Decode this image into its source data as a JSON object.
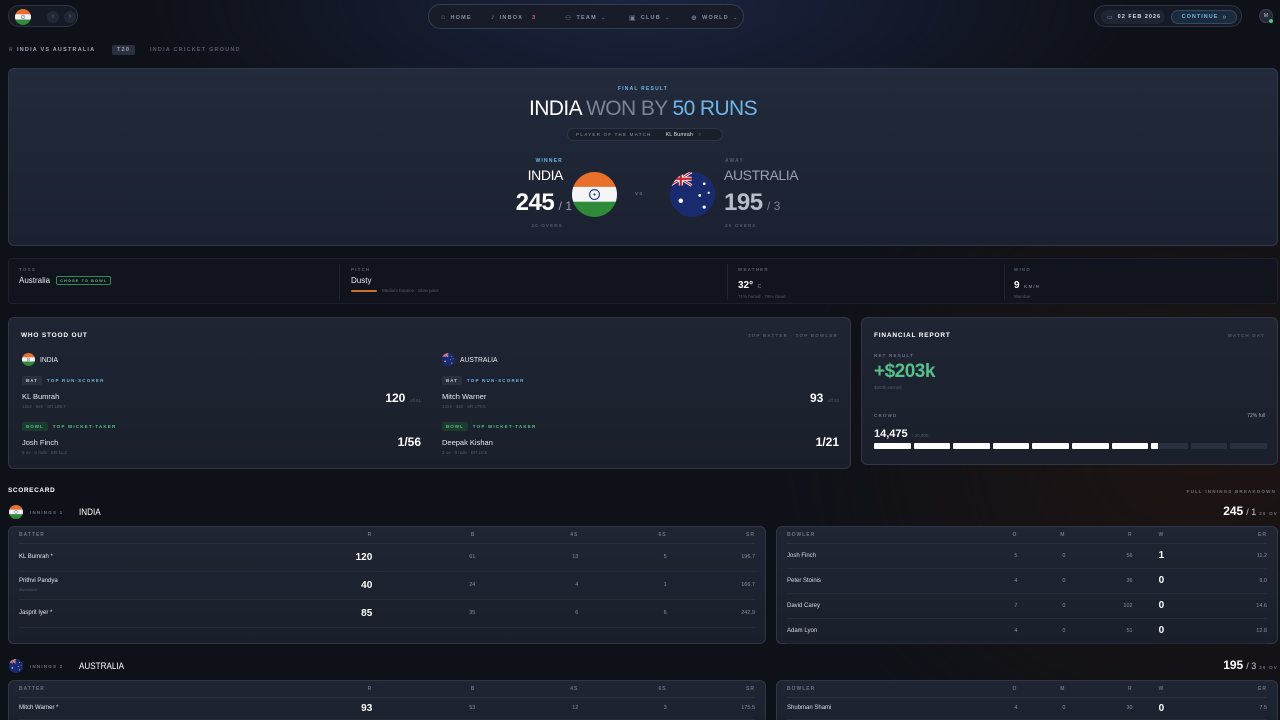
{
  "topbar": {
    "nav": [
      {
        "label": "HOME",
        "icon": "home-icon"
      },
      {
        "label": "INBOX",
        "icon": "bell-icon",
        "badge": "3"
      },
      {
        "label": "TEAM",
        "icon": "people-icon"
      },
      {
        "label": "CLUB",
        "icon": "briefcase-icon"
      },
      {
        "label": "WORLD",
        "icon": "globe-icon"
      }
    ],
    "date": "02 FEB 2026",
    "continue": "CONTINUE",
    "avatar": "M"
  },
  "breadcrumb": {
    "match": "INDIA VS AUSTRALIA",
    "format": "T20",
    "venue": "INDIA CRICKET GROUND"
  },
  "hero": {
    "kicker": "FINAL RESULT",
    "title_team": "INDIA",
    "title_mid": "WON BY",
    "title_margin": "50 RUNS",
    "potm_label": "PLAYER OF THE MATCH",
    "potm_name": "KL Bumrah",
    "home": {
      "tag": "WINNER",
      "name": "INDIA",
      "runs": "245",
      "wkts": "/ 1",
      "overs": "20 OVERS"
    },
    "vs": "VS",
    "away": {
      "tag": "AWAY",
      "name": "AUSTRALIA",
      "runs": "195",
      "wkts": "/ 3",
      "overs": "20 OVERS"
    }
  },
  "conditions": {
    "toss_label": "TOSS",
    "toss_value": "Australia",
    "toss_tag": "CHOSE TO BOWL",
    "pitch_label": "PITCH",
    "pitch_value": "Dusty",
    "pitch_desc": "Medium bounce · Slow pace",
    "weather_label": "WEATHER",
    "weather_value": "32°",
    "weather_unit": "C",
    "weather_desc": "71% humid · 76% cloud",
    "wind_label": "WIND",
    "wind_value": "9",
    "wind_unit": "KM/H",
    "wind_desc": "Mumbai"
  },
  "standout": {
    "title": "WHO STOOD OUT",
    "subtitle": "TOP BATTER · TOP BOWLER",
    "india": {
      "name": "INDIA",
      "bat_tag": "BAT",
      "bat_role": "TOP RUN-SCORER",
      "bat_player": "KL Bumrah",
      "bat_detail": "12x4 · 5x6 · SR 196.7",
      "bat_runs": "120",
      "bat_balls": "off 61",
      "bowl_tag": "BOWL",
      "bowl_role": "TOP WICKET-TAKER",
      "bowl_player": "Josh Finch",
      "bowl_detail": "5 ov · 0 mdn · ER 11.2",
      "bowl_figs": "1/56"
    },
    "australia": {
      "name": "AUSTRALIA",
      "bat_tag": "BAT",
      "bat_role": "TOP RUN-SCORER",
      "bat_player": "Mitch Warner",
      "bat_detail": "12x4 · 3x6 · SR 175.5",
      "bat_runs": "93",
      "bat_balls": "off 53",
      "bowl_tag": "BOWL",
      "bowl_role": "TOP WICKET-TAKER",
      "bowl_player": "Deepak Kishan",
      "bowl_detail": "2 ov · 0 mdn · ER 10.5",
      "bowl_figs": "1/21"
    }
  },
  "financial": {
    "title": "FINANCIAL REPORT",
    "subtitle": "MATCH DAY",
    "net_label": "NET RESULT",
    "net_value": "+$203k",
    "net_desc": "$203k earned",
    "crowd_label": "CROWD",
    "crowd_value": "14,475",
    "crowd_cap": "/ 20,000",
    "crowd_pct": "72% full",
    "crowd_fill": 0.72,
    "segments": 10
  },
  "scorecard": {
    "title": "SCORECARD",
    "subtitle": "FULL INNINGS BREAKDOWN",
    "innings": [
      {
        "label": "INNINGS 1",
        "team": "INDIA",
        "score": "245",
        "wkts": "/ 1",
        "overs": "20 OV",
        "bat_headers": [
          "BATTER",
          "R",
          "B",
          "4S",
          "6S",
          "SR"
        ],
        "batters": [
          {
            "name": "KL Bumrah *",
            "sub": "",
            "r": "120",
            "b": "61",
            "f": "13",
            "s": "5",
            "sr": "196.7"
          },
          {
            "name": "Prithvi Pandya",
            "sub": "dismissed",
            "r": "40",
            "b": "24",
            "f": "4",
            "s": "1",
            "sr": "166.7"
          },
          {
            "name": "Jasprit Iyer *",
            "sub": "",
            "r": "85",
            "b": "35",
            "f": "6",
            "s": "6",
            "sr": "242.9"
          }
        ],
        "bowl_headers": [
          "BOWLER",
          "O",
          "M",
          "R",
          "W",
          "ER"
        ],
        "bowlers": [
          {
            "name": "Josh Finch",
            "o": "5",
            "m": "0",
            "r": "56",
            "w": "1",
            "er": "11.2"
          },
          {
            "name": "Peter Stoinis",
            "o": "4",
            "m": "0",
            "r": "36",
            "w": "0",
            "er": "9.0"
          },
          {
            "name": "David Carey",
            "o": "7",
            "m": "0",
            "r": "102",
            "w": "0",
            "er": "14.6"
          },
          {
            "name": "Adam Lyon",
            "o": "4",
            "m": "0",
            "r": "51",
            "w": "0",
            "er": "12.8"
          }
        ]
      },
      {
        "label": "INNINGS 2",
        "team": "AUSTRALIA",
        "score": "195",
        "wkts": "/ 3",
        "overs": "20 OV",
        "bat_headers": [
          "BATTER",
          "R",
          "B",
          "4S",
          "6S",
          "SR"
        ],
        "batters": [
          {
            "name": "Mitch Warner *",
            "sub": "",
            "r": "93",
            "b": "53",
            "f": "12",
            "s": "3",
            "sr": "175.5"
          }
        ],
        "bowl_headers": [
          "BOWLER",
          "O",
          "M",
          "R",
          "W",
          "ER"
        ],
        "bowlers": [
          {
            "name": "Shubman Shami",
            "o": "4",
            "m": "0",
            "r": "30",
            "w": "0",
            "er": "7.5"
          }
        ]
      }
    ]
  },
  "colors": {
    "accent": "#6fb6e8",
    "green": "#54c08a",
    "india_saffron": "#e8702a",
    "india_green": "#2f8a3a"
  }
}
